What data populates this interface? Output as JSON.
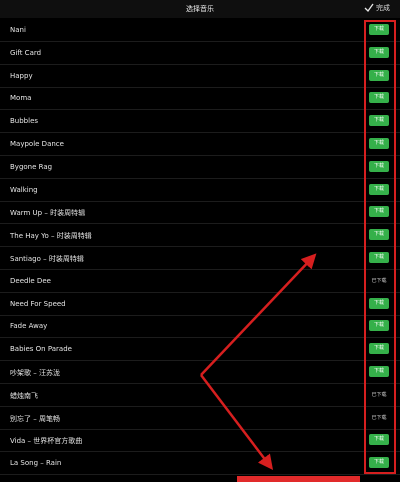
{
  "header": {
    "title": "选择音乐",
    "done_label": "完成"
  },
  "colors": {
    "accent": "#35b04a",
    "annotation": "#d61f1f",
    "background": "#000000"
  },
  "songs": [
    {
      "name": "Nani",
      "action": "下载",
      "downloaded": false
    },
    {
      "name": "Gift Card",
      "action": "下载",
      "downloaded": false
    },
    {
      "name": "Happy",
      "action": "下载",
      "downloaded": false
    },
    {
      "name": "Moma",
      "action": "下载",
      "downloaded": false
    },
    {
      "name": "Bubbles",
      "action": "下载",
      "downloaded": false
    },
    {
      "name": "Maypole Dance",
      "action": "下载",
      "downloaded": false
    },
    {
      "name": "Bygone Rag",
      "action": "下载",
      "downloaded": false
    },
    {
      "name": "Walking",
      "action": "下载",
      "downloaded": false
    },
    {
      "name": "Warm Up – 时装周特辑",
      "action": "下载",
      "downloaded": false
    },
    {
      "name": "The Hay Yo – 时装周特辑",
      "action": "下载",
      "downloaded": false
    },
    {
      "name": "Santiago – 时装周特辑",
      "action": "下载",
      "downloaded": false
    },
    {
      "name": "Deedle Dee",
      "action": "已下载",
      "downloaded": true
    },
    {
      "name": "Need For Speed",
      "action": "下载",
      "downloaded": false
    },
    {
      "name": "Fade Away",
      "action": "下载",
      "downloaded": false
    },
    {
      "name": "Babies On Parade",
      "action": "下载",
      "downloaded": false
    },
    {
      "name": "吵架歌 – 汪苏泷",
      "action": "下载",
      "downloaded": false
    },
    {
      "name": "蜡烛南飞",
      "action": "已下载",
      "downloaded": true
    },
    {
      "name": "别忘了 – 周笔畅",
      "action": "已下载",
      "downloaded": true
    },
    {
      "name": "Vida – 世界杯官方歌曲",
      "action": "下载",
      "downloaded": false
    },
    {
      "name": "La Song – Rain",
      "action": "下载",
      "downloaded": false
    }
  ]
}
